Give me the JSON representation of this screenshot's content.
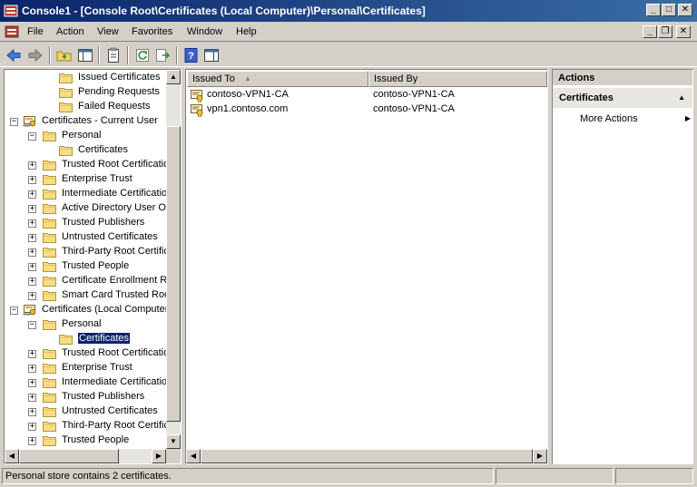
{
  "window": {
    "title": "Console1 - [Console Root\\Certificates (Local Computer)\\Personal\\Certificates]",
    "minimize": "_",
    "maximize": "□",
    "close": "✕",
    "doc_minimize": "_",
    "doc_restore": "❐",
    "doc_close": "✕"
  },
  "menu": [
    "File",
    "Action",
    "View",
    "Favorites",
    "Window",
    "Help"
  ],
  "toolbar_icons": [
    "back-arrow-icon",
    "forward-arrow-icon",
    "up-folder-icon",
    "show-hide-tree-icon",
    "properties-icon",
    "refresh-icon",
    "export-list-icon",
    "help-icon",
    "show-hide-action-pane-icon"
  ],
  "tree": [
    {
      "label": "Issued Certificates",
      "level": 2,
      "expander": ""
    },
    {
      "label": "Pending Requests",
      "level": 2,
      "expander": ""
    },
    {
      "label": "Failed Requests",
      "level": 2,
      "expander": ""
    },
    {
      "label": "Certificates - Current User",
      "level": 0,
      "expander": "−",
      "cert_icon": true
    },
    {
      "label": "Personal",
      "level": 1,
      "expander": "−"
    },
    {
      "label": "Certificates",
      "level": 2,
      "expander": ""
    },
    {
      "label": "Trusted Root Certification Authorities",
      "level": 1,
      "expander": "+"
    },
    {
      "label": "Enterprise Trust",
      "level": 1,
      "expander": "+"
    },
    {
      "label": "Intermediate Certification Authorities",
      "level": 1,
      "expander": "+"
    },
    {
      "label": "Active Directory User Object",
      "level": 1,
      "expander": "+"
    },
    {
      "label": "Trusted Publishers",
      "level": 1,
      "expander": "+"
    },
    {
      "label": "Untrusted Certificates",
      "level": 1,
      "expander": "+"
    },
    {
      "label": "Third-Party Root Certification Authorities",
      "level": 1,
      "expander": "+"
    },
    {
      "label": "Trusted People",
      "level": 1,
      "expander": "+"
    },
    {
      "label": "Certificate Enrollment Requests",
      "level": 1,
      "expander": "+"
    },
    {
      "label": "Smart Card Trusted Roots",
      "level": 1,
      "expander": "+"
    },
    {
      "label": "Certificates (Local Computer)",
      "level": 0,
      "expander": "−",
      "cert_icon": true
    },
    {
      "label": "Personal",
      "level": 1,
      "expander": "−"
    },
    {
      "label": "Certificates",
      "level": 2,
      "expander": "",
      "selected": true
    },
    {
      "label": "Trusted Root Certification Authorities",
      "level": 1,
      "expander": "+"
    },
    {
      "label": "Enterprise Trust",
      "level": 1,
      "expander": "+"
    },
    {
      "label": "Intermediate Certification Authorities",
      "level": 1,
      "expander": "+"
    },
    {
      "label": "Trusted Publishers",
      "level": 1,
      "expander": "+"
    },
    {
      "label": "Untrusted Certificates",
      "level": 1,
      "expander": "+"
    },
    {
      "label": "Third-Party Root Certification Authorities",
      "level": 1,
      "expander": "+"
    },
    {
      "label": "Trusted People",
      "level": 1,
      "expander": "+"
    }
  ],
  "list": {
    "columns": [
      "Issued To",
      "Issued By"
    ],
    "sort_indicator": "▲",
    "rows": [
      {
        "issued_to": "contoso-VPN1-CA",
        "issued_by": "contoso-VPN1-CA"
      },
      {
        "issued_to": "vpn1.contoso.com",
        "issued_by": "contoso-VPN1-CA"
      }
    ]
  },
  "actions": {
    "header": "Actions",
    "section": "Certificates",
    "section_arrow": "▲",
    "items": [
      {
        "label": "More Actions",
        "arrow": "▶"
      }
    ]
  },
  "scroll": {
    "up": "▲",
    "down": "▼",
    "left": "◀",
    "right": "▶"
  },
  "status": {
    "text": "Personal store contains 2 certificates."
  },
  "colors": {
    "title_start": "#0a246a",
    "title_end": "#3a6ea5",
    "selection": "#0a246a",
    "chrome": "#d4d0c8"
  }
}
